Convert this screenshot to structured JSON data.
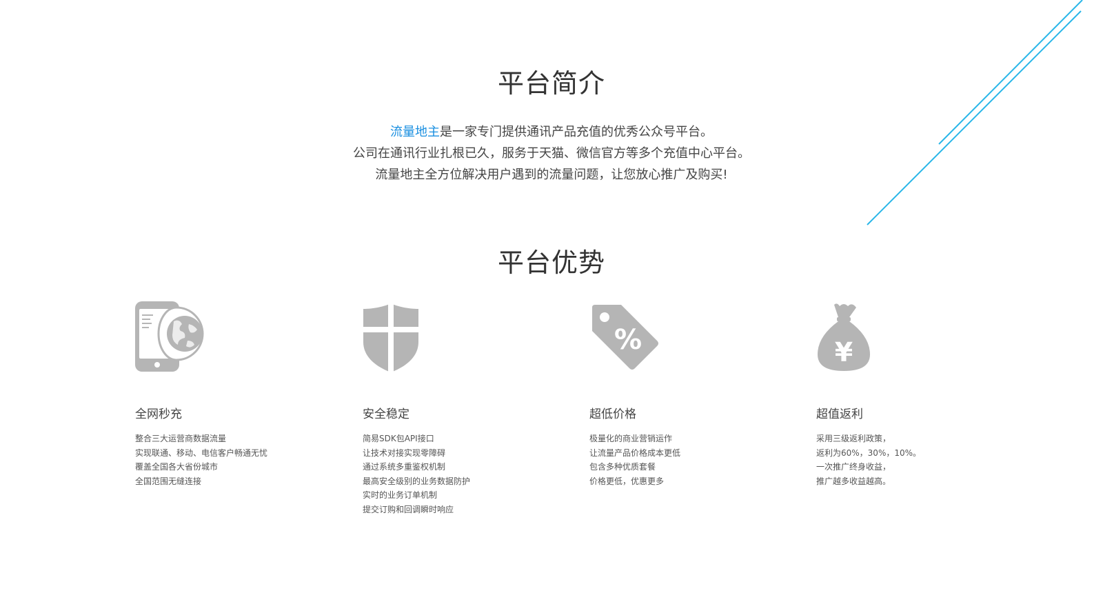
{
  "intro": {
    "title": "平台简介",
    "brand": "流量地主",
    "line1_rest": "是一家专门提供通讯产品充值的优秀公众号平台。",
    "line2": "公司在通讯行业扎根已久，服务于天猫、微信官方等多个充值中心平台。",
    "line3": "流量地主全方位解决用户遇到的流量问题，让您放心推广及购买!"
  },
  "advantages": {
    "title": "平台优势",
    "features": [
      {
        "icon": "phone-globe-icon",
        "title": "全网秒充",
        "lines": [
          "整合三大运营商数据流量",
          "实现联通、移动、电信客户畅通无忧",
          "覆盖全国各大省份城市",
          "全国范围无缝连接"
        ]
      },
      {
        "icon": "shield-icon",
        "title": "安全稳定",
        "lines": [
          "简易SDK包API接口",
          "让技术对接实现零障碍",
          "通过系统多重鉴权机制",
          "最高安全级别的业务数据防护",
          "实时的业务订单机制",
          "提交订购和回调瞬时响应"
        ]
      },
      {
        "icon": "discount-tag-icon",
        "title": "超低价格",
        "lines": [
          "极量化的商业营销运作",
          "让流量产品价格成本更低",
          "包含多种优质套餐",
          "价格更低，优惠更多"
        ]
      },
      {
        "icon": "money-bag-icon",
        "title": "超值返利",
        "lines": [
          "采用三级返利政策，",
          "返利为60%，30%，10%。",
          "一次推广终身收益，",
          "推广越多收益越高。"
        ]
      }
    ]
  },
  "colors": {
    "accent": "#1a8fe0",
    "deco_line": "#29b6e8",
    "icon_gray": "#b5b5b5"
  }
}
